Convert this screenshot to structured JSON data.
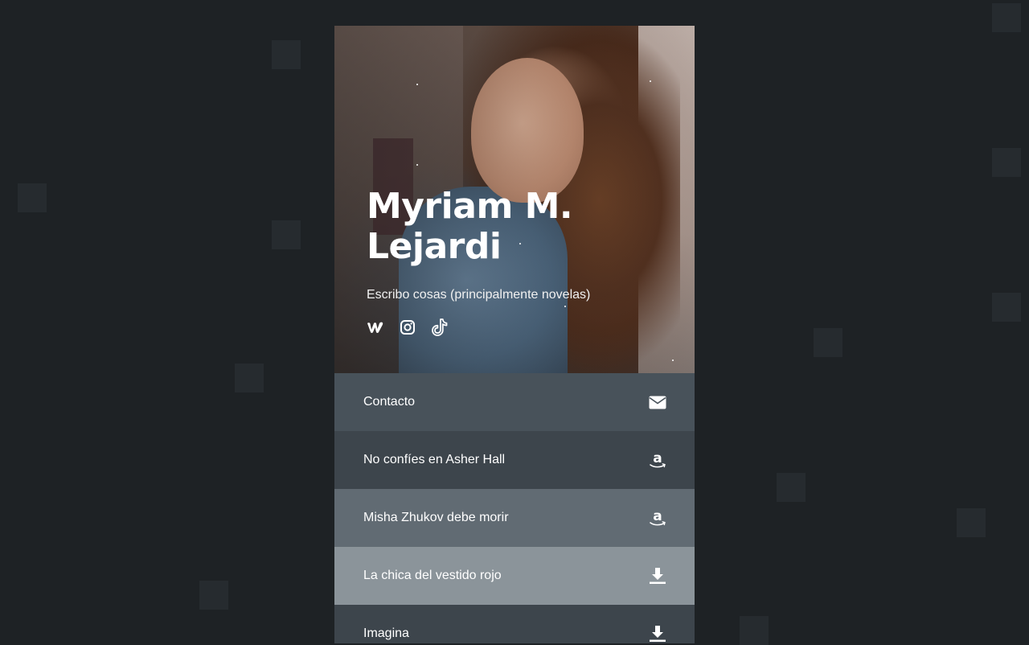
{
  "profile": {
    "name_line1": "Myriam M.",
    "name_line2": "Lejardi",
    "tagline": "Escribo cosas (principalmente novelas)"
  },
  "socials": [
    {
      "icon": "wattpad-icon"
    },
    {
      "icon": "instagram-icon"
    },
    {
      "icon": "tiktok-icon"
    }
  ],
  "links": [
    {
      "label": "Contacto",
      "icon": "envelope-icon",
      "color": "#48525a"
    },
    {
      "label": "No confíes en Asher Hall",
      "icon": "amazon-icon",
      "color": "#3d454c"
    },
    {
      "label": "Misha Zhukov debe morir",
      "icon": "amazon-icon",
      "color": "#616b73"
    },
    {
      "label": "La chica del vestido rojo",
      "icon": "download-icon",
      "color": "#8b949a"
    },
    {
      "label": "Imagina",
      "icon": "download-icon",
      "color": "#3d454c"
    }
  ],
  "colors": {
    "background": "#1e2225",
    "text": "#ffffff"
  }
}
